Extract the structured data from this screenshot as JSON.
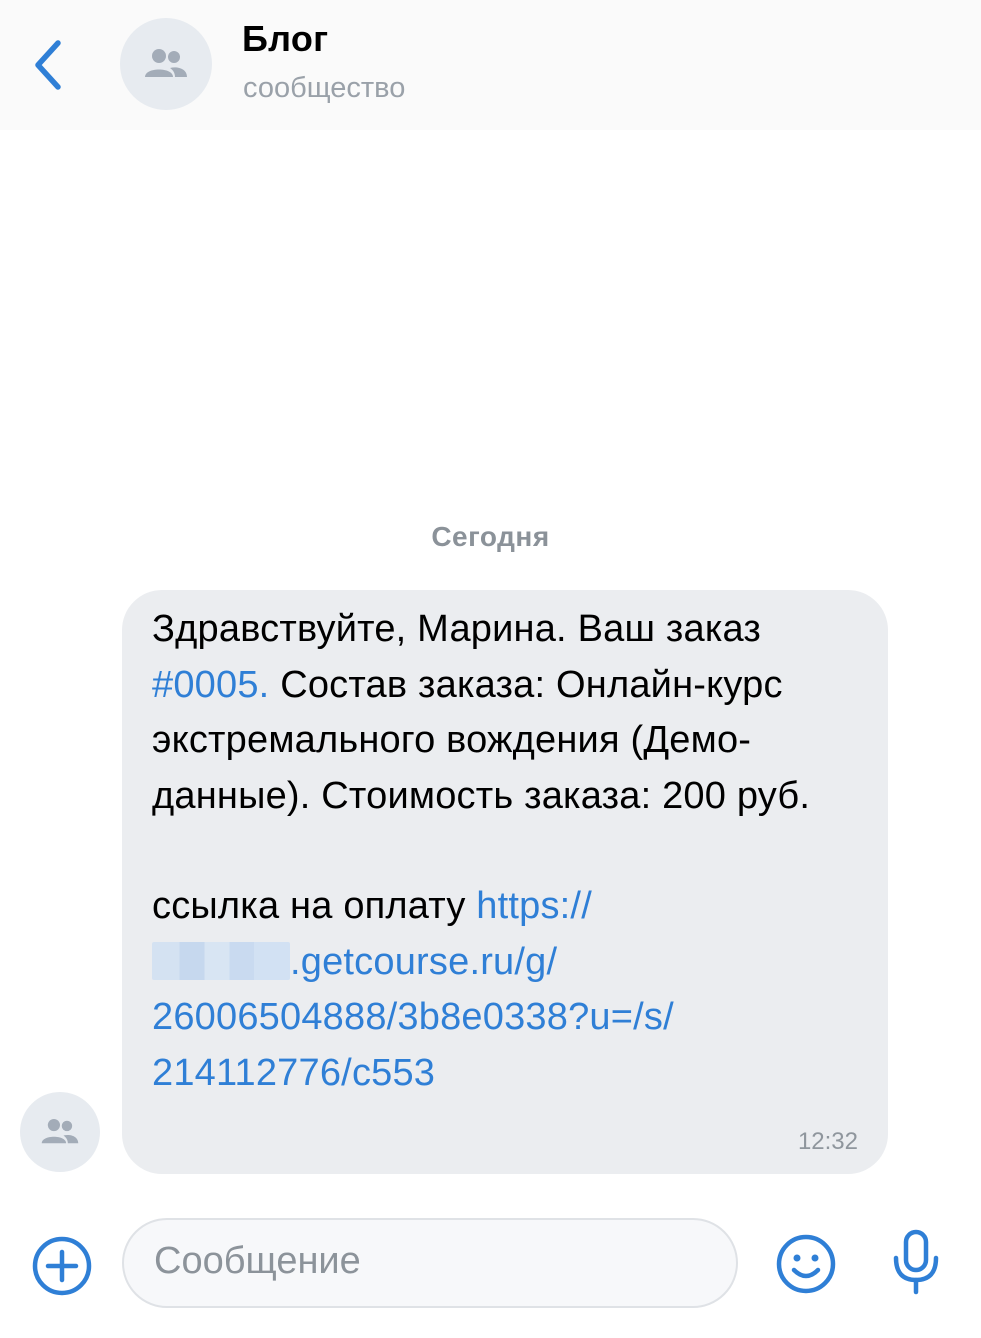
{
  "header": {
    "back_icon": "chevron-left-icon",
    "avatar_icon": "group-icon",
    "title": "Блог",
    "subtitle": "сообщество"
  },
  "chat": {
    "date_separator": "Сегодня",
    "message": {
      "text_1": "Здравствуйте, Марина. Ваш заказ ",
      "order_link": "#0005.",
      "text_2": " Состав заказа: Онлайн-курс экстремального вождения (Демо-данные). Стоимость заказа: 200 руб.",
      "payment_label": "ссылка на оплату ",
      "url_part_1": "https://",
      "url_part_2": ".getcourse.ru/g/",
      "url_part_3": "26006504888/3b8e0338?u=/s/",
      "url_part_4": "214112776/c553",
      "time": "12:32"
    }
  },
  "composer": {
    "placeholder": "Сообщение",
    "add_icon": "plus-circle-icon",
    "emoji_icon": "smile-icon",
    "mic_icon": "microphone-icon"
  },
  "colors": {
    "accent": "#2f7fd6",
    "bubble": "#ebedf0",
    "secondary_text": "#8b9299"
  }
}
